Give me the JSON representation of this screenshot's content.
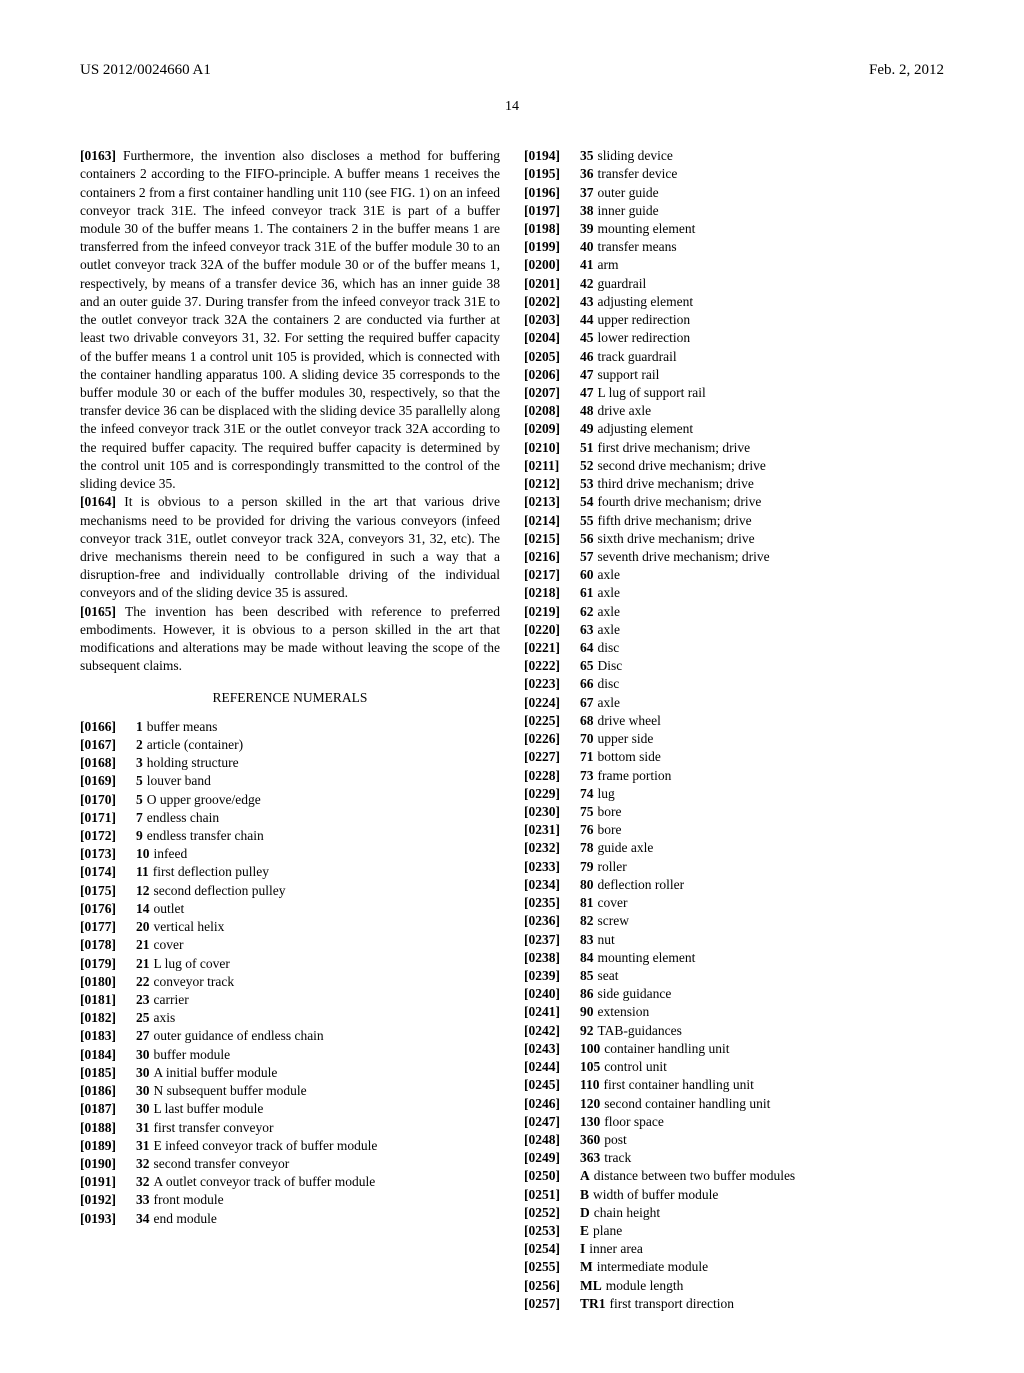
{
  "header": {
    "pub_number": "US 2012/0024660 A1",
    "date": "Feb. 2, 2012"
  },
  "page_number": "14",
  "paragraphs": {
    "p0163": "  Furthermore, the invention also discloses a method for buffering containers 2 according to the FIFO-principle. A buffer means 1 receives the containers 2 from a first container handling unit 110 (see FIG. 1) on an infeed conveyor track 31E. The infeed conveyor track 31E is part of a buffer module 30 of the buffer means 1. The containers 2 in the buffer means 1 are transferred from the infeed conveyor track 31E of the buffer module 30 to an outlet conveyor track 32A of the buffer module 30 or of the buffer means 1, respectively, by means of a transfer device 36, which has an inner guide 38 and an outer guide 37. During transfer from the infeed conveyor track 31E to the outlet conveyor track 32A the containers 2 are conducted via further at least two drivable conveyors 31, 32. For setting the required buffer capacity of the buffer means 1 a control unit 105 is provided, which is connected with the container handling apparatus 100. A sliding device 35 corresponds to the buffer module 30 or each of the buffer modules 30, respectively, so that the transfer device 36 can be displaced with the sliding device 35 parallelly along the infeed conveyor track 31E or the outlet conveyor track 32A according to the required buffer capacity. The required buffer capacity is determined by the control unit 105 and is correspondingly transmitted to the control of the sliding device 35.",
    "p0164": "  It is obvious to a person skilled in the art that various drive mechanisms need to be provided for driving the various conveyors (infeed conveyor track 31E, outlet conveyor track 32A, conveyors 31, 32, etc). The drive mechanisms therein need to be configured in such a way that a disruption-free and individually controllable driving of the individual conveyors and of the sliding device 35 is assured.",
    "p0165": "  The invention has been described with reference to preferred embodiments. However, it is obvious to a person skilled in the art that modifications and alterations may be made without leaving the scope of the subsequent claims."
  },
  "section_heading": "REFERENCE NUMERALS",
  "refs_left": [
    {
      "pnum": "[0166]",
      "key": "1",
      "text": "buffer means"
    },
    {
      "pnum": "[0167]",
      "key": "2",
      "text": "article (container)"
    },
    {
      "pnum": "[0168]",
      "key": "3",
      "text": "holding structure"
    },
    {
      "pnum": "[0169]",
      "key": "5",
      "text": "louver band"
    },
    {
      "pnum": "[0170]",
      "key": "5",
      "text": "O upper groove/edge"
    },
    {
      "pnum": "[0171]",
      "key": "7",
      "text": "endless chain"
    },
    {
      "pnum": "[0172]",
      "key": "9",
      "text": "endless transfer chain"
    },
    {
      "pnum": "[0173]",
      "key": "10",
      "text": "infeed"
    },
    {
      "pnum": "[0174]",
      "key": "11",
      "text": "first deflection pulley"
    },
    {
      "pnum": "[0175]",
      "key": "12",
      "text": "second deflection pulley"
    },
    {
      "pnum": "[0176]",
      "key": "14",
      "text": "outlet"
    },
    {
      "pnum": "[0177]",
      "key": "20",
      "text": "vertical helix"
    },
    {
      "pnum": "[0178]",
      "key": "21",
      "text": "cover"
    },
    {
      "pnum": "[0179]",
      "key": "21",
      "text": "L lug of cover"
    },
    {
      "pnum": "[0180]",
      "key": "22",
      "text": "conveyor track"
    },
    {
      "pnum": "[0181]",
      "key": "23",
      "text": "carrier"
    },
    {
      "pnum": "[0182]",
      "key": "25",
      "text": "axis"
    },
    {
      "pnum": "[0183]",
      "key": "27",
      "text": "outer guidance of endless chain"
    },
    {
      "pnum": "[0184]",
      "key": "30",
      "text": "buffer module"
    },
    {
      "pnum": "[0185]",
      "key": "30",
      "text": "A initial buffer module"
    },
    {
      "pnum": "[0186]",
      "key": "30",
      "text": "N subsequent buffer module"
    },
    {
      "pnum": "[0187]",
      "key": "30",
      "text": "L last buffer module"
    },
    {
      "pnum": "[0188]",
      "key": "31",
      "text": "first transfer conveyor"
    },
    {
      "pnum": "[0189]",
      "key": "31",
      "text": "E infeed conveyor track of buffer module"
    },
    {
      "pnum": "[0190]",
      "key": "32",
      "text": "second transfer conveyor"
    },
    {
      "pnum": "[0191]",
      "key": "32",
      "text": "A outlet conveyor track of buffer module"
    },
    {
      "pnum": "[0192]",
      "key": "33",
      "text": "front module"
    },
    {
      "pnum": "[0193]",
      "key": "34",
      "text": "end module"
    }
  ],
  "refs_right": [
    {
      "pnum": "[0194]",
      "key": "35",
      "text": "sliding device"
    },
    {
      "pnum": "[0195]",
      "key": "36",
      "text": "transfer device"
    },
    {
      "pnum": "[0196]",
      "key": "37",
      "text": "outer guide"
    },
    {
      "pnum": "[0197]",
      "key": "38",
      "text": "inner guide"
    },
    {
      "pnum": "[0198]",
      "key": "39",
      "text": "mounting element"
    },
    {
      "pnum": "[0199]",
      "key": "40",
      "text": "transfer means"
    },
    {
      "pnum": "[0200]",
      "key": "41",
      "text": "arm"
    },
    {
      "pnum": "[0201]",
      "key": "42",
      "text": "guardrail"
    },
    {
      "pnum": "[0202]",
      "key": "43",
      "text": "adjusting element"
    },
    {
      "pnum": "[0203]",
      "key": "44",
      "text": "upper redirection"
    },
    {
      "pnum": "[0204]",
      "key": "45",
      "text": "lower redirection"
    },
    {
      "pnum": "[0205]",
      "key": "46",
      "text": "track guardrail"
    },
    {
      "pnum": "[0206]",
      "key": "47",
      "text": "support rail"
    },
    {
      "pnum": "[0207]",
      "key": "47",
      "text": "L lug of support rail"
    },
    {
      "pnum": "[0208]",
      "key": "48",
      "text": "drive axle"
    },
    {
      "pnum": "[0209]",
      "key": "49",
      "text": "adjusting element"
    },
    {
      "pnum": "[0210]",
      "key": "51",
      "text": "first drive mechanism; drive"
    },
    {
      "pnum": "[0211]",
      "key": "52",
      "text": "second drive mechanism; drive"
    },
    {
      "pnum": "[0212]",
      "key": "53",
      "text": "third drive mechanism; drive"
    },
    {
      "pnum": "[0213]",
      "key": "54",
      "text": "fourth drive mechanism; drive"
    },
    {
      "pnum": "[0214]",
      "key": "55",
      "text": "fifth drive mechanism; drive"
    },
    {
      "pnum": "[0215]",
      "key": "56",
      "text": "sixth drive mechanism; drive"
    },
    {
      "pnum": "[0216]",
      "key": "57",
      "text": "seventh drive mechanism; drive"
    },
    {
      "pnum": "[0217]",
      "key": "60",
      "text": "axle"
    },
    {
      "pnum": "[0218]",
      "key": "61",
      "text": "axle"
    },
    {
      "pnum": "[0219]",
      "key": "62",
      "text": "axle"
    },
    {
      "pnum": "[0220]",
      "key": "63",
      "text": "axle"
    },
    {
      "pnum": "[0221]",
      "key": "64",
      "text": "disc"
    },
    {
      "pnum": "[0222]",
      "key": "65",
      "text": "Disc"
    },
    {
      "pnum": "[0223]",
      "key": "66",
      "text": "disc"
    },
    {
      "pnum": "[0224]",
      "key": "67",
      "text": "axle"
    },
    {
      "pnum": "[0225]",
      "key": "68",
      "text": "drive wheel"
    },
    {
      "pnum": "[0226]",
      "key": "70",
      "text": "upper side"
    },
    {
      "pnum": "[0227]",
      "key": "71",
      "text": "bottom side"
    },
    {
      "pnum": "[0228]",
      "key": "73",
      "text": "frame portion"
    },
    {
      "pnum": "[0229]",
      "key": "74",
      "text": "lug"
    },
    {
      "pnum": "[0230]",
      "key": "75",
      "text": "bore"
    },
    {
      "pnum": "[0231]",
      "key": "76",
      "text": "bore"
    },
    {
      "pnum": "[0232]",
      "key": "78",
      "text": "guide axle"
    },
    {
      "pnum": "[0233]",
      "key": "79",
      "text": "roller"
    },
    {
      "pnum": "[0234]",
      "key": "80",
      "text": "deflection roller"
    },
    {
      "pnum": "[0235]",
      "key": "81",
      "text": "cover"
    },
    {
      "pnum": "[0236]",
      "key": "82",
      "text": "screw"
    },
    {
      "pnum": "[0237]",
      "key": "83",
      "text": "nut"
    },
    {
      "pnum": "[0238]",
      "key": "84",
      "text": "mounting element"
    },
    {
      "pnum": "[0239]",
      "key": "85",
      "text": "seat"
    },
    {
      "pnum": "[0240]",
      "key": "86",
      "text": "side guidance"
    },
    {
      "pnum": "[0241]",
      "key": "90",
      "text": "extension"
    },
    {
      "pnum": "[0242]",
      "key": "92",
      "text": "TAB-guidances"
    },
    {
      "pnum": "[0243]",
      "key": "100",
      "text": "container handling unit"
    },
    {
      "pnum": "[0244]",
      "key": "105",
      "text": "control unit"
    },
    {
      "pnum": "[0245]",
      "key": "110",
      "text": "first container handling unit"
    },
    {
      "pnum": "[0246]",
      "key": "120",
      "text": "second container handling unit"
    },
    {
      "pnum": "[0247]",
      "key": "130",
      "text": "floor space"
    },
    {
      "pnum": "[0248]",
      "key": "360",
      "text": "post"
    },
    {
      "pnum": "[0249]",
      "key": "363",
      "text": "track"
    },
    {
      "pnum": "[0250]",
      "key": "A",
      "text": "distance between two buffer modules"
    },
    {
      "pnum": "[0251]",
      "key": "B",
      "text": "width of buffer module"
    },
    {
      "pnum": "[0252]",
      "key": "D",
      "text": "chain height"
    },
    {
      "pnum": "[0253]",
      "key": "E",
      "text": "plane"
    },
    {
      "pnum": "[0254]",
      "key": "I",
      "text": "inner area"
    },
    {
      "pnum": "[0255]",
      "key": "M",
      "text": "intermediate module"
    },
    {
      "pnum": "[0256]",
      "key": "ML",
      "text": "module length"
    },
    {
      "pnum": "[0257]",
      "key": "TR1",
      "text": "first transport direction"
    }
  ],
  "para_nums": {
    "p0163": "[0163]",
    "p0164": "[0164]",
    "p0165": "[0165]"
  }
}
